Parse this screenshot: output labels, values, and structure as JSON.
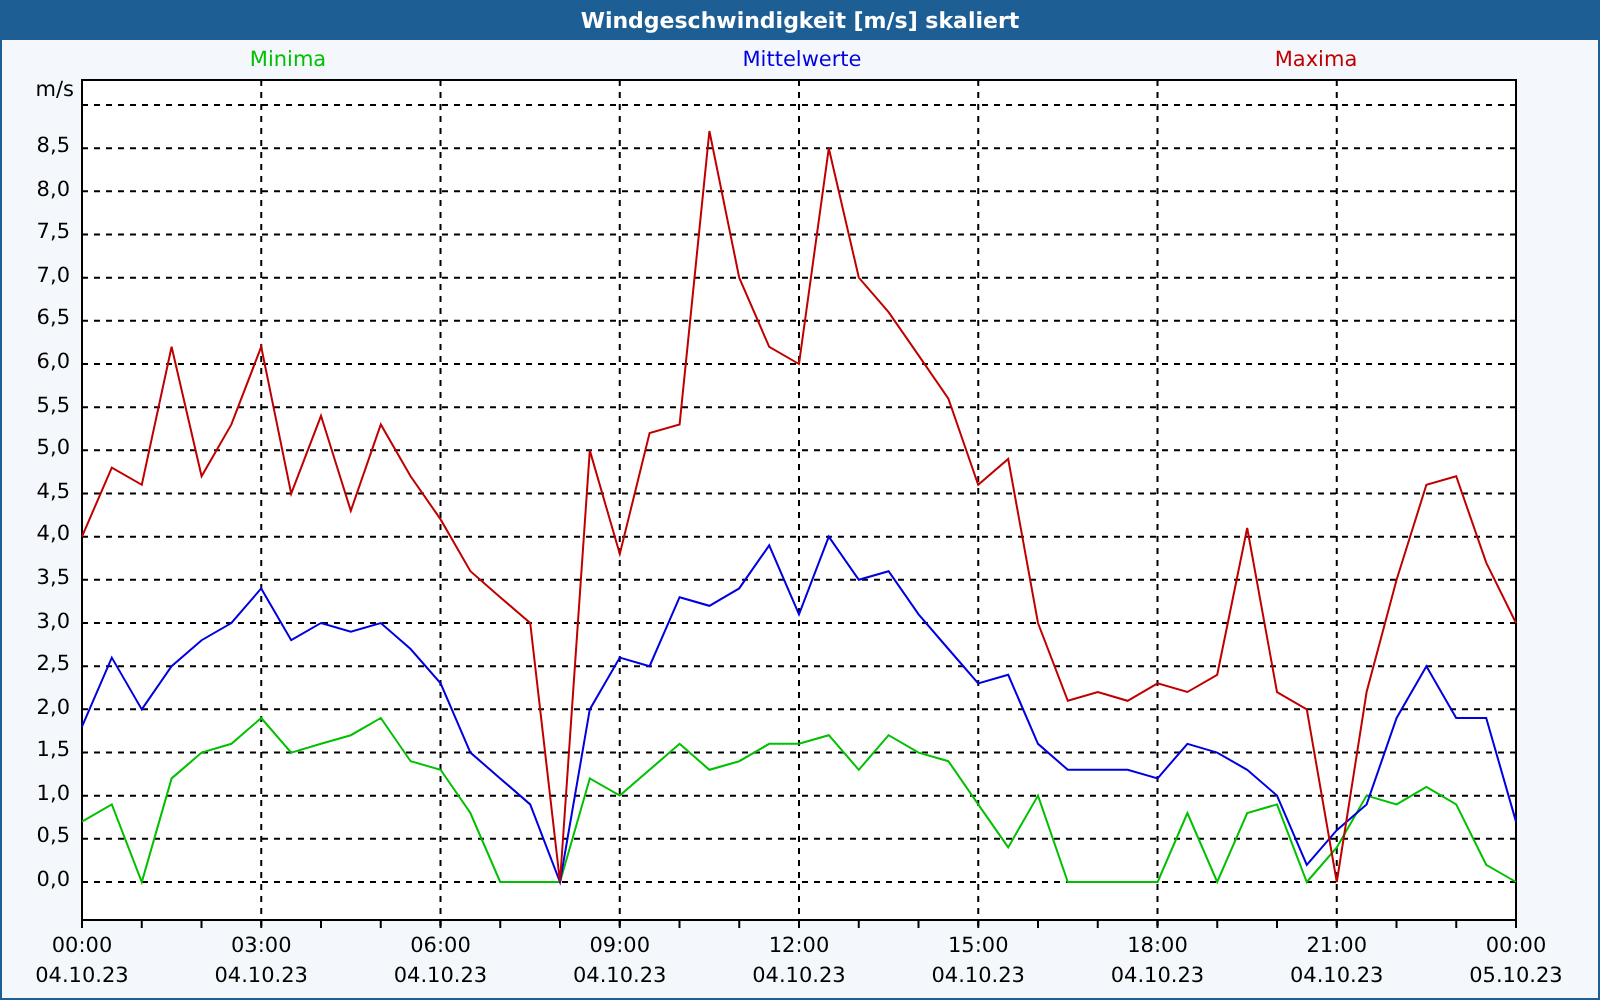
{
  "window": {
    "title": "Windgeschwindigkeit [m/s] skaliert"
  },
  "chart_data": {
    "type": "line",
    "ylabel": "m/s",
    "categories": [
      "00:00 04.10.23",
      null,
      null,
      null,
      null,
      null,
      "03:00 04.10.23",
      null,
      null,
      null,
      null,
      null,
      "06:00 04.10.23",
      null,
      null,
      null,
      null,
      null,
      "09:00 04.10.23",
      null,
      null,
      null,
      null,
      null,
      "12:00 04.10.23",
      null,
      null,
      null,
      null,
      null,
      "15:00 04.10.23",
      null,
      null,
      null,
      null,
      null,
      "18:00 04.10.23",
      null,
      null,
      null,
      null,
      null,
      "21:00 04.10.23",
      null,
      null,
      null,
      null,
      null,
      "00:00 05.10.23"
    ],
    "series": [
      {
        "name": "Minima",
        "color": "#00c000",
        "values": [
          0.7,
          0.9,
          0.0,
          1.2,
          1.5,
          1.6,
          1.9,
          1.5,
          1.6,
          1.7,
          1.9,
          1.4,
          1.3,
          0.8,
          0.0,
          0.0,
          0.0,
          1.2,
          1.0,
          1.3,
          1.6,
          1.3,
          1.4,
          1.6,
          1.6,
          1.7,
          1.3,
          1.7,
          1.5,
          1.4,
          0.9,
          0.4,
          1.0,
          0.0,
          0.0,
          0.0,
          0.0,
          0.8,
          0.0,
          0.8,
          0.9,
          0.0,
          0.4,
          1.0,
          0.9,
          1.1,
          0.9,
          0.2,
          0.0
        ]
      },
      {
        "name": "Mittelwerte",
        "color": "#0000e0",
        "values": [
          1.8,
          2.6,
          2.0,
          2.5,
          2.8,
          3.0,
          3.4,
          2.8,
          3.0,
          2.9,
          3.0,
          2.7,
          2.3,
          1.5,
          1.2,
          0.9,
          0.0,
          2.0,
          2.6,
          2.5,
          3.3,
          3.2,
          3.4,
          3.9,
          3.1,
          4.0,
          3.5,
          3.6,
          3.1,
          2.7,
          2.3,
          2.4,
          1.6,
          1.3,
          1.3,
          1.3,
          1.2,
          1.6,
          1.5,
          1.3,
          1.0,
          0.2,
          0.6,
          0.9,
          1.9,
          2.5,
          1.9,
          1.9,
          0.7
        ]
      },
      {
        "name": "Maxima",
        "color": "#c00000",
        "values": [
          4.0,
          4.8,
          4.6,
          6.2,
          4.7,
          5.3,
          6.2,
          4.5,
          5.4,
          4.3,
          5.3,
          4.7,
          4.2,
          3.6,
          3.3,
          3.0,
          0.0,
          5.0,
          3.8,
          5.2,
          5.3,
          8.7,
          7.0,
          6.2,
          6.0,
          8.5,
          7.0,
          6.6,
          6.1,
          5.6,
          4.6,
          4.9,
          3.0,
          2.1,
          2.2,
          2.1,
          2.3,
          2.2,
          2.4,
          4.1,
          2.2,
          2.0,
          0.0,
          2.2,
          3.5,
          4.6,
          4.7,
          3.7,
          3.0
        ]
      }
    ],
    "ylim": [
      -0.44,
      9.29
    ],
    "grid": true,
    "yticks": [
      {
        "value": 0,
        "label": "0,0"
      },
      {
        "value": 0.5,
        "label": "0,5"
      },
      {
        "value": 1,
        "label": "1,0"
      },
      {
        "value": 1.5,
        "label": "1,5"
      },
      {
        "value": 2,
        "label": "2,0"
      },
      {
        "value": 2.5,
        "label": "2,5"
      },
      {
        "value": 3,
        "label": "3,0"
      },
      {
        "value": 3.5,
        "label": "3,5"
      },
      {
        "value": 4,
        "label": "4,0"
      },
      {
        "value": 4.5,
        "label": "4,5"
      },
      {
        "value": 5,
        "label": "5,0"
      },
      {
        "value": 5.5,
        "label": "5,5"
      },
      {
        "value": 6,
        "label": "6,0"
      },
      {
        "value": 6.5,
        "label": "6,5"
      },
      {
        "value": 7,
        "label": "7,0"
      },
      {
        "value": 7.5,
        "label": "7,5"
      },
      {
        "value": 8,
        "label": "8,0"
      },
      {
        "value": 8.5,
        "label": "8,5"
      }
    ]
  }
}
